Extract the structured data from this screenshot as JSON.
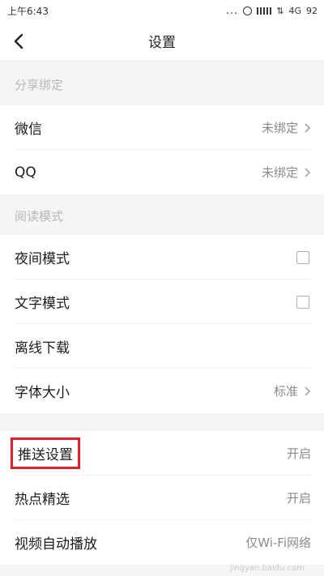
{
  "status": {
    "time": "上午6:43",
    "dots": "...",
    "network": "4G",
    "battery": "92"
  },
  "nav": {
    "title": "设置"
  },
  "sections": {
    "share": "分享绑定",
    "read": "阅读模式"
  },
  "rows": {
    "wechat": {
      "label": "微信",
      "value": "未绑定"
    },
    "qq": {
      "label": "QQ",
      "value": "未绑定"
    },
    "night": {
      "label": "夜间模式"
    },
    "text": {
      "label": "文字模式"
    },
    "offline": {
      "label": "离线下载"
    },
    "font": {
      "label": "字体大小",
      "value": "标准"
    },
    "push": {
      "label": "推送设置",
      "value": "开启"
    },
    "hot": {
      "label": "热点精选",
      "value": "开启"
    },
    "video": {
      "label": "视频自动播放",
      "value": "仅Wi-Fi网络"
    }
  },
  "colors": {
    "highlight": "#e3202a",
    "section_text": "#b8b8b8"
  },
  "watermark": "jingyan.baidu.com"
}
